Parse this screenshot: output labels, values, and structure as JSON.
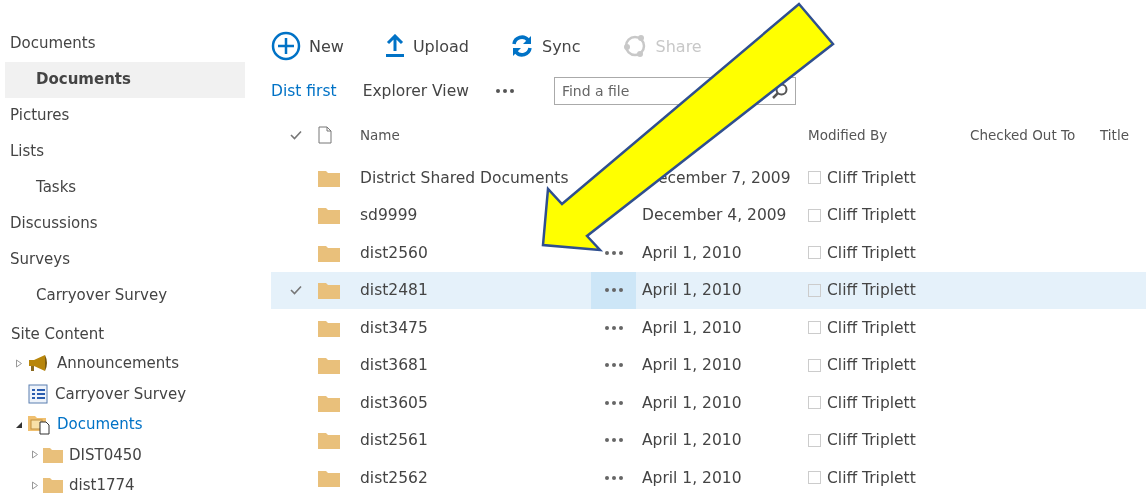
{
  "sidebar": {
    "items": [
      {
        "label": "Documents",
        "indent": false,
        "selected": false
      },
      {
        "label": "Documents",
        "indent": true,
        "selected": true
      },
      {
        "label": "Pictures",
        "indent": false,
        "selected": false
      },
      {
        "label": "Lists",
        "indent": false,
        "selected": false
      },
      {
        "label": "Tasks",
        "indent": true,
        "selected": false
      },
      {
        "label": "Discussions",
        "indent": false,
        "selected": false
      },
      {
        "label": "Surveys",
        "indent": false,
        "selected": false
      },
      {
        "label": "Carryover Survey",
        "indent": true,
        "selected": false
      }
    ],
    "site_content": {
      "title": "Site Content",
      "tree": [
        {
          "label": "Announcements",
          "kind": "announcements",
          "expanded": false,
          "expandable": true
        },
        {
          "label": "Carryover Survey",
          "kind": "survey",
          "expandable": false
        },
        {
          "label": "Documents",
          "kind": "library",
          "expanded": true,
          "expandable": true,
          "children": [
            {
              "label": "DIST0450",
              "kind": "folder",
              "expanded": false,
              "expandable": true
            },
            {
              "label": "dist1774",
              "kind": "folder",
              "expanded": false,
              "expandable": true
            }
          ]
        }
      ]
    }
  },
  "toolbar": [
    {
      "label": "New",
      "kind": "new",
      "disabled": false
    },
    {
      "label": "Upload",
      "kind": "upload",
      "disabled": false
    },
    {
      "label": "Sync",
      "kind": "sync",
      "disabled": false
    },
    {
      "label": "Share",
      "kind": "share",
      "disabled": true
    }
  ],
  "views": [
    {
      "label": "Dist first",
      "selected": true
    },
    {
      "label": "Explorer View",
      "selected": false
    }
  ],
  "search": {
    "placeholder": "Find a file"
  },
  "table": {
    "columns": [
      "Name",
      "Modified By",
      "Checked Out To",
      "Title"
    ],
    "rows": [
      {
        "name": "District Shared Documents",
        "modified": "ecember 7, 2009",
        "modified_by": "Cliff Triplett",
        "selected": false,
        "menu": false
      },
      {
        "name": "sd9999",
        "modified": "December 4, 2009",
        "modified_by": "Cliff Triplett",
        "selected": false,
        "menu": false
      },
      {
        "name": "dist2560",
        "modified": "April 1, 2010",
        "modified_by": "Cliff Triplett",
        "selected": false,
        "menu": true
      },
      {
        "name": "dist2481",
        "modified": "April 1, 2010",
        "modified_by": "Cliff Triplett",
        "selected": true,
        "menu": true
      },
      {
        "name": "dist3475",
        "modified": "April 1, 2010",
        "modified_by": "Cliff Triplett",
        "selected": false,
        "menu": true
      },
      {
        "name": "dist3681",
        "modified": "April 1, 2010",
        "modified_by": "Cliff Triplett",
        "selected": false,
        "menu": true
      },
      {
        "name": "dist3605",
        "modified": "April 1, 2010",
        "modified_by": "Cliff Triplett",
        "selected": false,
        "menu": true
      },
      {
        "name": "dist2561",
        "modified": "April 1, 2010",
        "modified_by": "Cliff Triplett",
        "selected": false,
        "menu": true
      },
      {
        "name": "dist2562",
        "modified": "April 1, 2010",
        "modified_by": "Cliff Triplett",
        "selected": false,
        "menu": true
      }
    ]
  }
}
